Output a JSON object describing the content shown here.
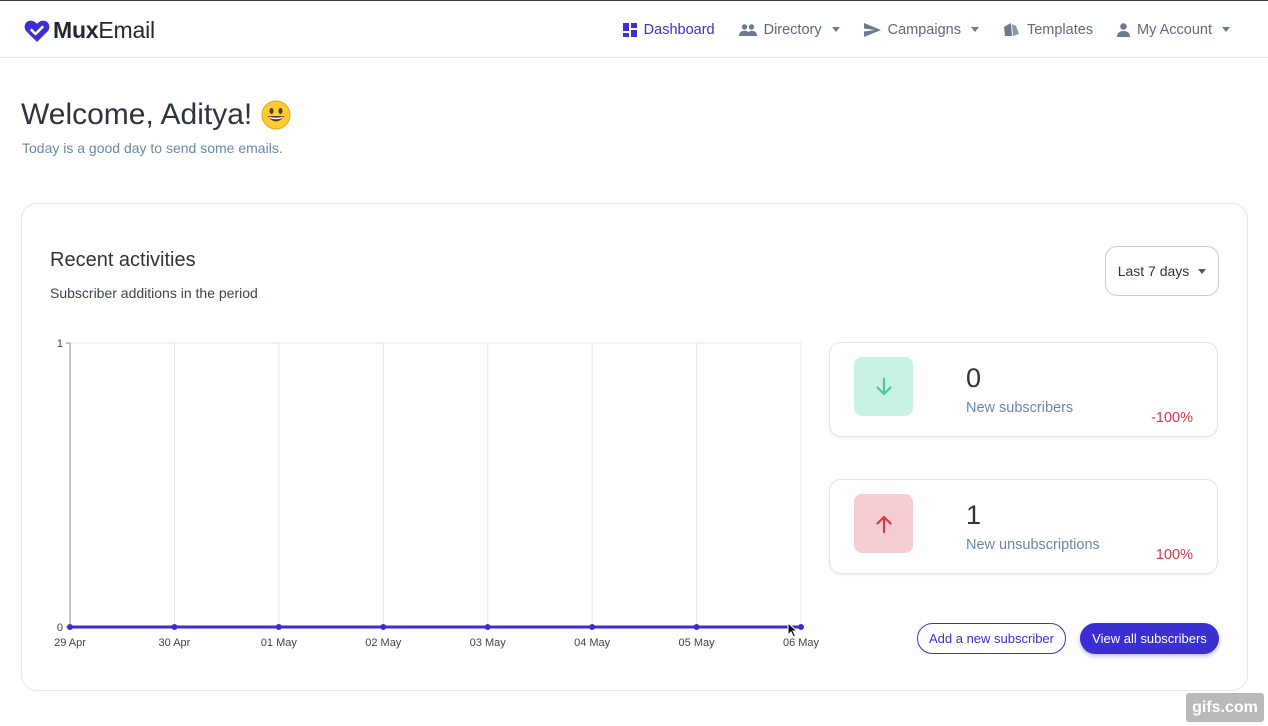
{
  "brand": {
    "name_bold": "Mux",
    "name_regular": "Email",
    "logo_icon": "heart-check-icon",
    "accent": "#3b2fd1"
  },
  "nav": {
    "items": [
      {
        "label": "Dashboard",
        "icon": "dashboard-icon",
        "active": true
      },
      {
        "label": "Directory",
        "icon": "people-icon",
        "has_caret": true
      },
      {
        "label": "Campaigns",
        "icon": "send-icon",
        "has_caret": true
      },
      {
        "label": "Templates",
        "icon": "layers-icon"
      },
      {
        "label": "My Account",
        "icon": "person-icon",
        "has_caret": true
      }
    ]
  },
  "welcome": {
    "title": "Welcome, Aditya!",
    "emoji": "😀",
    "subtitle": "Today is a good day to send some emails."
  },
  "activities": {
    "title": "Recent activities",
    "subtitle": "Subscriber additions in the period",
    "range_label": "Last 7 days"
  },
  "chart_data": {
    "type": "line",
    "title": "",
    "xlabel": "",
    "ylabel": "",
    "categories": [
      "29 Apr",
      "30 Apr",
      "01 May",
      "02 May",
      "03 May",
      "04 May",
      "05 May",
      "06 May"
    ],
    "series": [
      {
        "values": [
          0,
          0,
          0,
          0,
          0,
          0,
          0,
          0
        ],
        "color": "#3b2fd1"
      }
    ],
    "y_ticks": [
      "0",
      "1"
    ],
    "ylim": [
      0,
      1
    ],
    "grid": true,
    "legend": "none"
  },
  "stats": [
    {
      "value": "0",
      "label": "New subscribers",
      "change": "-100%",
      "direction": "down",
      "box_color": "#c8f3e3",
      "arrow_color": "#4cc99a",
      "icon": "arrow-down-icon"
    },
    {
      "value": "1",
      "label": "New unsubscriptions",
      "change": "100%",
      "direction": "up",
      "box_color": "#f6cdd2",
      "arrow_color": "#d9374b",
      "icon": "arrow-up-icon"
    }
  ],
  "buttons": {
    "add_subscriber": "Add a new subscriber",
    "view_all": "View all subscribers"
  },
  "watermark": "gifs.com"
}
